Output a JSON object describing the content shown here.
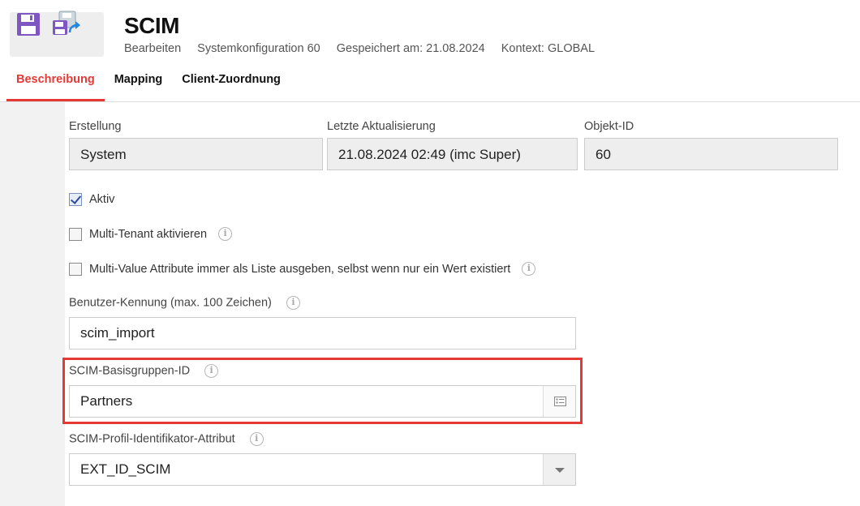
{
  "header": {
    "title": "SCIM",
    "meta": [
      "Bearbeiten",
      "Systemkonfiguration 60",
      "Gespeichert am: 21.08.2024",
      "Kontext: GLOBAL"
    ],
    "save_icon": "floppy-disk-icon",
    "save_as_icon": "floppy-disk-export-icon",
    "icon_color": "#7e57c2"
  },
  "tabs": [
    {
      "label": "Beschreibung",
      "active": true
    },
    {
      "label": "Mapping",
      "active": false
    },
    {
      "label": "Client-Zuordnung",
      "active": false
    }
  ],
  "info": {
    "created_label": "Erstellung",
    "created_value": "System",
    "updated_label": "Letzte Aktualisierung",
    "updated_value": "21.08.2024 02:49 (imc Super)",
    "objid_label": "Objekt-ID",
    "objid_value": "60"
  },
  "checkboxes": [
    {
      "label": "Aktiv",
      "checked": true,
      "info": false
    },
    {
      "label": "Multi-Tenant aktivieren",
      "checked": false,
      "info": true
    },
    {
      "label": "Multi-Value Attribute immer als Liste ausgeben, selbst wenn nur ein Wert existiert",
      "checked": false,
      "info": true
    }
  ],
  "fields": {
    "user_id_label": "Benutzer-Kennung (max. 100 Zeichen)",
    "user_id_value": "scim_import",
    "base_group_label": "SCIM-Basisgruppen-ID",
    "base_group_value": "Partners",
    "profile_attr_label": "SCIM-Profil-Identifikator-Attribut",
    "profile_attr_value": "EXT_ID_SCIM"
  },
  "info_glyph": "i",
  "colors": {
    "accent": "#e53935",
    "highlight": "#e53935"
  }
}
